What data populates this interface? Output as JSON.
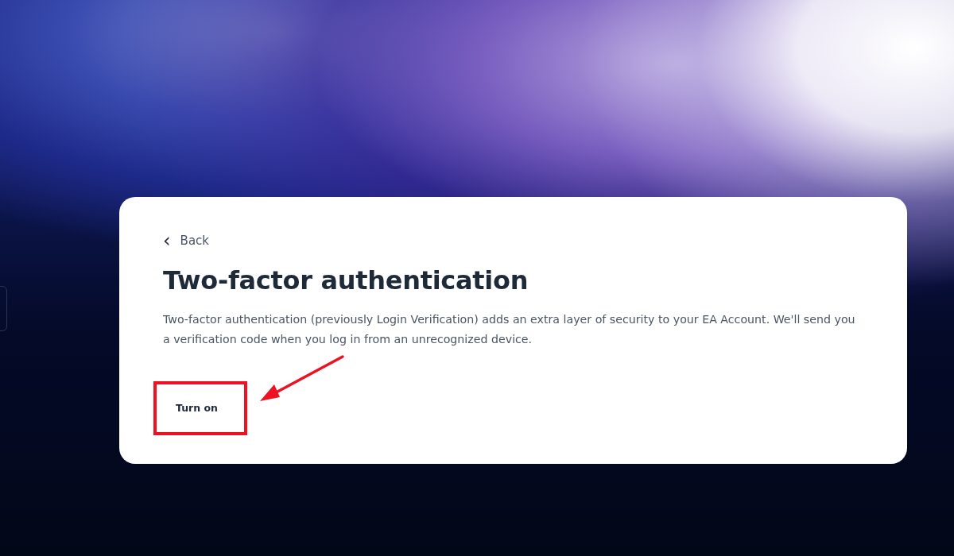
{
  "back_link": {
    "icon": "‹",
    "label": "Back"
  },
  "title": "Two-factor authentication",
  "description": "Two-factor authentication (previously Login Verification) adds an extra layer of security to your EA Account. We'll send you a verification code when you log in from an unrecognized device.",
  "button": {
    "label": "Turn on"
  }
}
